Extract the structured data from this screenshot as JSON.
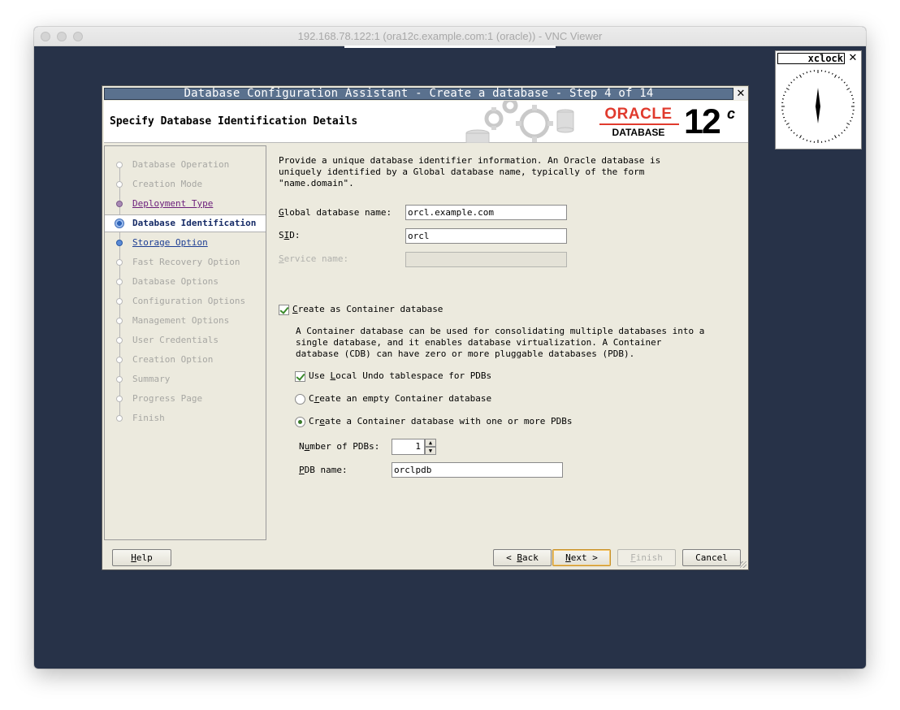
{
  "mac_window": {
    "title": "192.168.78.122:1 (ora12c.example.com:1 (oracle)) - VNC Viewer"
  },
  "dialog": {
    "title": "Database Configuration Assistant - Create a database - Step 4 of 14",
    "close_glyph": "✕",
    "header_title": "Specify Database Identification Details",
    "logo": {
      "brand": "ORACLE",
      "product": "DATABASE",
      "version": "12",
      "version_suffix": "c"
    }
  },
  "nav": {
    "items": [
      {
        "label": "Database Operation",
        "state": "disabled"
      },
      {
        "label": "Creation Mode",
        "state": "disabled"
      },
      {
        "label": "Deployment Type",
        "state": "visited"
      },
      {
        "label": "Database Identification",
        "state": "current"
      },
      {
        "label": "Storage Option",
        "state": "link"
      },
      {
        "label": "Fast Recovery Option",
        "state": "disabled"
      },
      {
        "label": "Database Options",
        "state": "disabled"
      },
      {
        "label": "Configuration Options",
        "state": "disabled"
      },
      {
        "label": "Management Options",
        "state": "disabled"
      },
      {
        "label": "User Credentials",
        "state": "disabled"
      },
      {
        "label": "Creation Option",
        "state": "disabled"
      },
      {
        "label": "Summary",
        "state": "disabled"
      },
      {
        "label": "Progress Page",
        "state": "disabled"
      },
      {
        "label": "Finish",
        "state": "disabled"
      }
    ]
  },
  "form": {
    "intro": "Provide a unique database identifier information. An Oracle database is\nuniquely identified by a Global database name, typically of the form\n\"name.domain\".",
    "global_db_name": {
      "label_u": "G",
      "label_rest": "lobal database name:",
      "value": "orcl.example.com"
    },
    "sid": {
      "label_pre": "S",
      "label_u": "I",
      "label_rest": "D:",
      "value": "orcl"
    },
    "service_name": {
      "label_u": "S",
      "label_rest": "ervice name:",
      "value": ""
    },
    "container_checkbox": {
      "label_u": "C",
      "label_rest": "reate as Container database",
      "checked": true
    },
    "container_desc": "A Container database can be used for consolidating multiple databases into a\nsingle database, and it enables database virtualization. A Container\ndatabase (CDB) can have zero or more pluggable databases (PDB).",
    "local_undo": {
      "label_pre": "Use ",
      "label_u": "L",
      "label_rest": "ocal Undo tablespace for PDBs",
      "checked": true
    },
    "radio_empty": {
      "label_pre": "C",
      "label_u": "r",
      "label_rest": "eate an empty Container database",
      "selected": false
    },
    "radio_with_pdbs": {
      "label_pre": "Cr",
      "label_u": "e",
      "label_rest": "ate a Container database with one or more PDBs",
      "selected": true
    },
    "num_pdbs": {
      "label_pre": "N",
      "label_u": "u",
      "label_rest": "mber of PDBs:",
      "value": "1"
    },
    "pdb_name": {
      "label_u": "P",
      "label_rest": "DB name:",
      "value": "orclpdb"
    }
  },
  "buttons": {
    "help": {
      "label_u": "H",
      "label_rest": "elp"
    },
    "back": {
      "label_pre": "< ",
      "label_u": "B",
      "label_rest": "ack"
    },
    "next": {
      "label_u": "N",
      "label_rest": "ext >"
    },
    "finish": {
      "label_u": "F",
      "label_rest": "inish",
      "enabled": false
    },
    "cancel": {
      "label": "Cancel"
    }
  },
  "xclock": {
    "title": "xclock",
    "close_glyph": "✕"
  },
  "colors": {
    "desktop": "#273248",
    "dialog_title_bar": "#5a718e",
    "dialog_bg": "#eceade",
    "oracle_red": "#e03a2d",
    "nav_current_text": "#152a66",
    "nav_visited_text": "#6b1d7a",
    "nav_link_text": "#1d3e94",
    "default_button_border": "#c8912a"
  }
}
